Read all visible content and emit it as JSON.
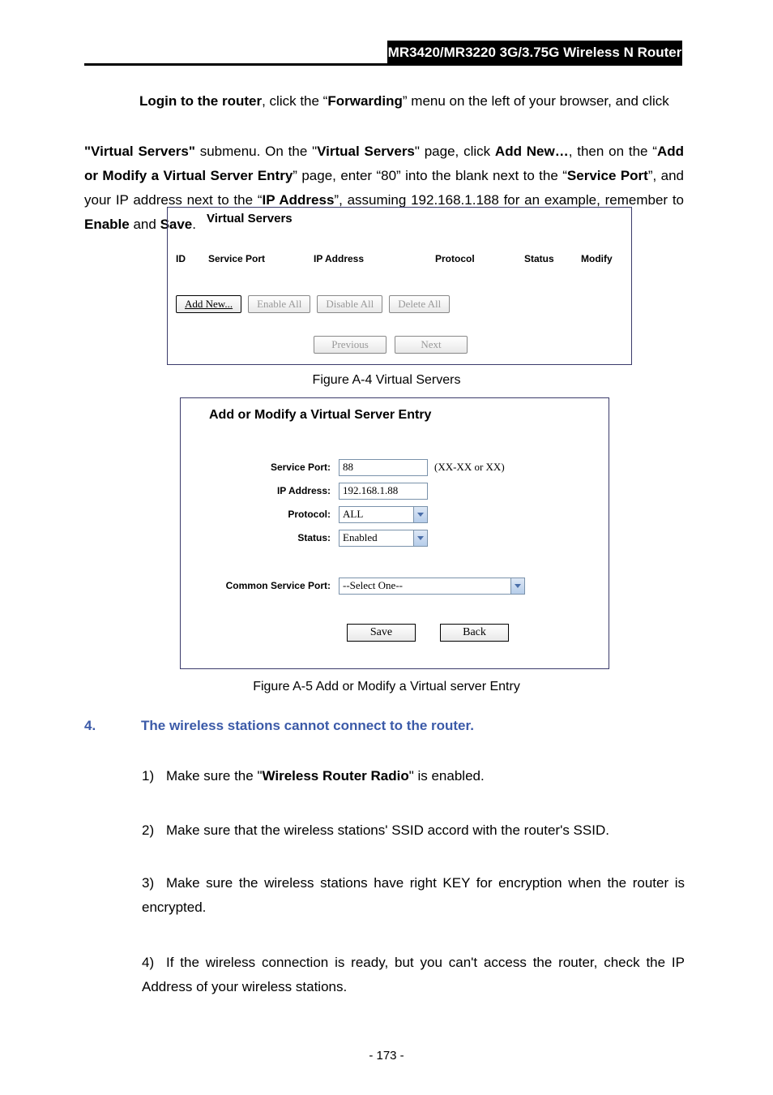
{
  "header": {
    "product": "MR3420/MR3220"
  },
  "intro": {
    "prefix": "Login to the router",
    "t1": ", click the “",
    "menu": "Forwarding",
    "t2": "” menu on the left of your browser, and click ",
    "submenu": "\"Virtual Servers\"",
    "t3": " submenu. On the \"",
    "pagename": "Virtual Servers",
    "t4": "\" page, click ",
    "addnew": "Add New…",
    "t5": ", then on the “",
    "addmod": "Add or Modify a Virtual Server Entry",
    "t6": "” page, enter “80” into the blank next to the “",
    "sp": "Service Port",
    "t7": "”, and your IP address next to the “",
    "ip": "IP Address",
    "t8": "”, assuming 192.168.1.188 for an example, remember to ",
    "enable": "Enable",
    "t9": " and ",
    "save": "Save",
    "t10": "."
  },
  "vs_panel": {
    "title": "Virtual Servers",
    "headers": {
      "id": "ID",
      "sp": "Service Port",
      "ip": "IP Address",
      "proto": "Protocol",
      "status": "Status",
      "modify": "Modify"
    },
    "buttons": {
      "addnew": "Add New...",
      "enable_all": "Enable All",
      "disable_all": "Disable All",
      "delete_all": "Delete All",
      "previous": "Previous",
      "next": "Next"
    }
  },
  "fig_a4": "Figure A-4 Virtual Servers",
  "am_panel": {
    "title": "Add or Modify a Virtual Server Entry",
    "labels": {
      "sp": "Service Port:",
      "ip": "IP Address:",
      "proto": "Protocol:",
      "status": "Status:",
      "csp": "Common Service Port:"
    },
    "values": {
      "sp": "88",
      "ip": "192.168.1.88",
      "proto": "ALL",
      "status": "Enabled",
      "csp": "--Select One--"
    },
    "hint": "(XX-XX or XX)",
    "buttons": {
      "save": "Save",
      "back": "Back"
    }
  },
  "fig_a5": "Figure A-5 Add or Modify a Virtual server Entry",
  "q4": {
    "label": "4.",
    "text": "The wireless stations cannot connect to the router."
  },
  "steps": {
    "s1_n": "1)",
    "s1": "Make sure the \"Wireless Router Radio\" is enabled.",
    "s2_n": "2)",
    "s2": "Make sure that the wireless stations' SSID accord with the router's SSID.",
    "s3_n": "3)",
    "s3": "Make sure the wireless stations have right KEY for encryption when the router is encrypted.",
    "s4_n": "4)",
    "s4": "If the wireless connection is ready, but you can't access the router, check the IP Address of your wireless stations."
  },
  "pagenum": "- 173 -"
}
